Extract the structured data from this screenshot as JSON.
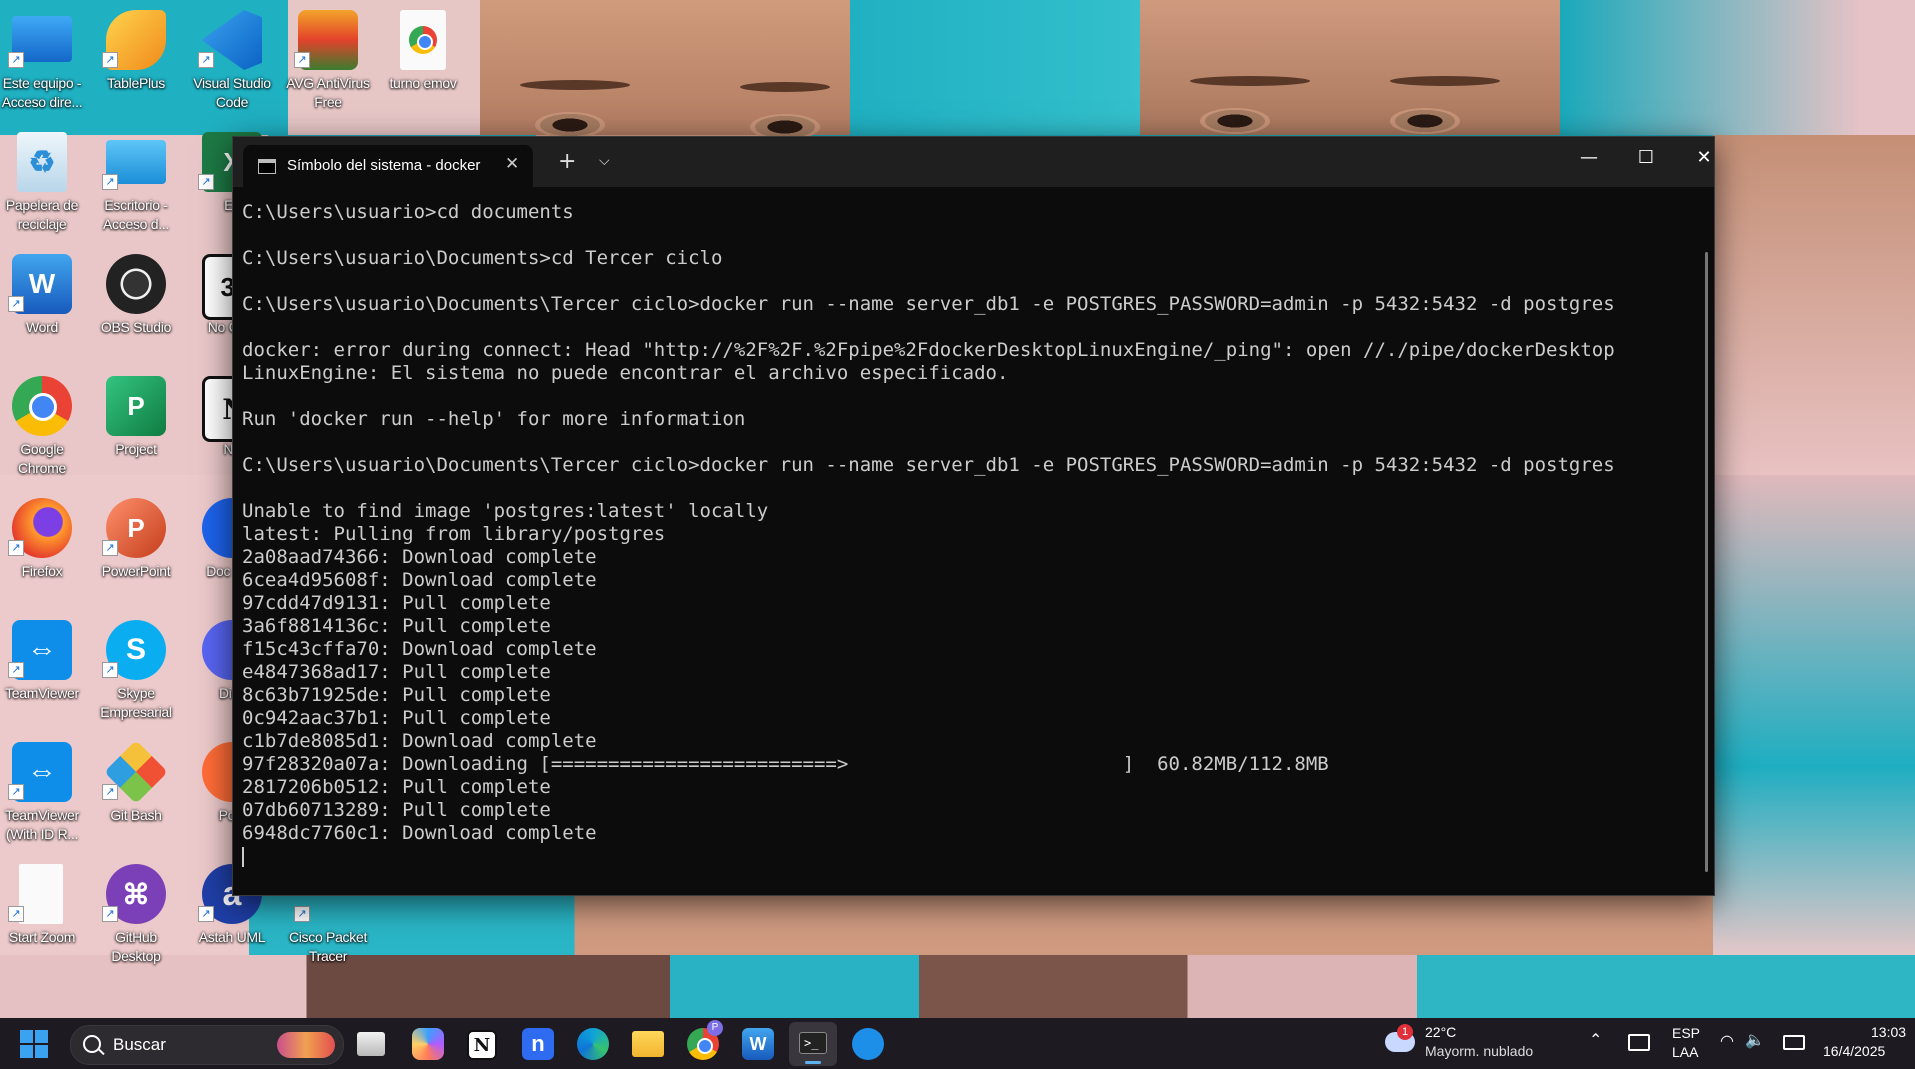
{
  "desktop": {
    "icons": [
      {
        "label": "Este equipo - Acceso dire...",
        "icon": "computer-icon"
      },
      {
        "label": "TablePlus",
        "icon": "tableplus-icon"
      },
      {
        "label": "Visual Studio Code",
        "icon": "vscode-icon"
      },
      {
        "label": "AVG AntiVirus Free",
        "icon": "avg-icon"
      },
      {
        "label": "turno emov",
        "icon": "chrome-file-icon"
      },
      {
        "label": "Papelera de reciclaje",
        "icon": "recycle-bin-icon"
      },
      {
        "label": "Escritorio - Acceso d...",
        "icon": "folder-icon"
      },
      {
        "label": "Ex",
        "icon": "excel-icon"
      },
      {
        "label": "Word",
        "icon": "word-icon"
      },
      {
        "label": "OBS Studio",
        "icon": "obs-icon"
      },
      {
        "label": "No Cale",
        "icon": "notion-calendar-icon"
      },
      {
        "label": "Google Chrome",
        "icon": "chrome-icon"
      },
      {
        "label": "Project",
        "icon": "project-icon"
      },
      {
        "label": "No",
        "icon": "notion-icon"
      },
      {
        "label": "Firefox",
        "icon": "firefox-icon"
      },
      {
        "label": "PowerPoint",
        "icon": "powerpoint-icon"
      },
      {
        "label": "Doc Des",
        "icon": "docker-desktop-icon"
      },
      {
        "label": "TeamViewer",
        "icon": "teamviewer-icon"
      },
      {
        "label": "Skype Empresarial",
        "icon": "skype-icon"
      },
      {
        "label": "Disc",
        "icon": "discord-icon"
      },
      {
        "label": "TeamViewer (With ID R...",
        "icon": "teamviewer-id-icon"
      },
      {
        "label": "Git Bash",
        "icon": "git-bash-icon"
      },
      {
        "label": "Post",
        "icon": "postman-icon"
      },
      {
        "label": "Start Zoom",
        "icon": "zoom-file-icon"
      },
      {
        "label": "GitHub Desktop",
        "icon": "github-icon"
      },
      {
        "label": "Astah UML",
        "icon": "astah-icon"
      },
      {
        "label": "Cisco Packet Tracer",
        "icon": "cisco-icon"
      }
    ]
  },
  "terminal": {
    "tab_title": "Símbolo del sistema - docker",
    "new_tab_glyph": "+",
    "tab_menu_glyph": "⌵",
    "close_tab_glyph": "✕",
    "minimize_glyph": "—",
    "maximize_glyph": "☐",
    "close_glyph": "✕",
    "lines": [
      "C:\\Users\\usuario>cd documents",
      "",
      "C:\\Users\\usuario\\Documents>cd Tercer ciclo",
      "",
      "C:\\Users\\usuario\\Documents\\Tercer ciclo>docker run --name server_db1 -e POSTGRES_PASSWORD=admin -p 5432:5432 -d postgres",
      "",
      "docker: error during connect: Head \"http://%2F%2F.%2Fpipe%2FdockerDesktopLinuxEngine/_ping\": open //./pipe/dockerDesktop",
      "LinuxEngine: El sistema no puede encontrar el archivo especificado.",
      "",
      "Run 'docker run --help' for more information",
      "",
      "C:\\Users\\usuario\\Documents\\Tercer ciclo>docker run --name server_db1 -e POSTGRES_PASSWORD=admin -p 5432:5432 -d postgres",
      "",
      "Unable to find image 'postgres:latest' locally",
      "latest: Pulling from library/postgres",
      "2a08aad74366: Download complete",
      "6cea4d95608f: Download complete",
      "97cdd47d9131: Pull complete",
      "3a6f8814136c: Pull complete",
      "f15c43cffa70: Download complete",
      "e4847368ad17: Pull complete",
      "8c63b71925de: Pull complete",
      "0c942aac37b1: Pull complete",
      "c1b7de8085d1: Download complete",
      "97f28320a07a: Downloading [=========================>                        ]  60.82MB/112.8MB",
      "2817206b0512: Pull complete",
      "07db60713289: Pull complete",
      "6948dc7760c1: Download complete"
    ]
  },
  "taskbar": {
    "search_placeholder": "Buscar",
    "weather_temp": "22°C",
    "weather_desc": "Mayorm. nublado",
    "weather_badge": "1",
    "lang_line1": "ESP",
    "lang_line2": "LAA",
    "time": "13:03",
    "date": "16/4/2025",
    "apps": [
      "copilot-icon",
      "notion-icon",
      "notion-n-icon",
      "edge-icon",
      "file-explorer-icon",
      "chrome-icon",
      "word-icon",
      "terminal-icon",
      "docker-icon"
    ]
  }
}
